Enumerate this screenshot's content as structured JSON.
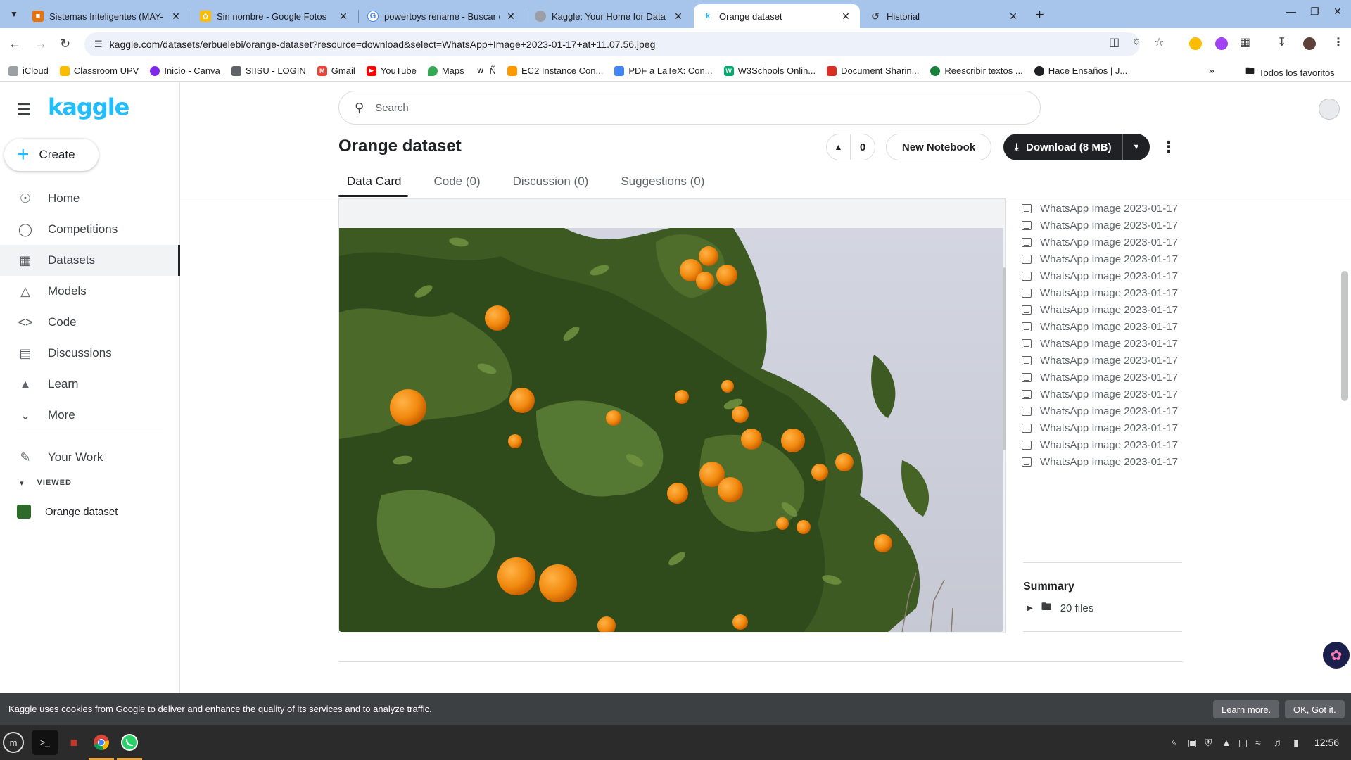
{
  "browser": {
    "tabs": [
      {
        "label": "Sistemas Inteligentes (MAY-",
        "color": "#e8710a"
      },
      {
        "label": "Sin nombre - Google Fotos",
        "color": "#fbbc04"
      },
      {
        "label": "powertoys rename - Buscar c",
        "color": "#4285f4"
      },
      {
        "label": "Kaggle: Your Home for Data",
        "color": "#9aa0a6"
      },
      {
        "label": "Orange dataset",
        "color": "#20beff"
      },
      {
        "label": "Historial",
        "color": "#5f6368"
      }
    ],
    "url": "kaggle.com/datasets/erbuelebi/orange-dataset?resource=download&select=WhatsApp+Image+2023-01-17+at+11.07.56.jpeg",
    "bookmarks": [
      {
        "label": "iCloud",
        "color": "#9aa0a6"
      },
      {
        "label": "Classroom UPV",
        "color": "#fbbc04"
      },
      {
        "label": "Inicio - Canva",
        "color": "#7d2ae8"
      },
      {
        "label": "SIISU - LOGIN",
        "color": "#5f6368"
      },
      {
        "label": "Gmail",
        "color": "#ea4335"
      },
      {
        "label": "YouTube",
        "color": "#ff0000"
      },
      {
        "label": "Maps",
        "color": "#34a853"
      },
      {
        "label": "Ñ",
        "color": "#202124"
      },
      {
        "label": "EC2 Instance Con...",
        "color": "#ff9900"
      },
      {
        "label": "PDF a LaTeX: Con...",
        "color": "#4285f4"
      },
      {
        "label": "W3Schools Onlin...",
        "color": "#04aa6d"
      },
      {
        "label": "Document Sharin...",
        "color": "#d93025"
      },
      {
        "label": "Reescribir textos ...",
        "color": "#188038"
      },
      {
        "label": "Hace Ensaños | J...",
        "color": "#202124"
      }
    ],
    "all_bookmarks": "Todos los favoritos"
  },
  "sidebar": {
    "logo": "kaggle",
    "create_label": "Create",
    "items": [
      {
        "label": "Home",
        "icon": "compass-icon"
      },
      {
        "label": "Competitions",
        "icon": "trophy-icon"
      },
      {
        "label": "Datasets",
        "icon": "table-icon"
      },
      {
        "label": "Models",
        "icon": "models-icon"
      },
      {
        "label": "Code",
        "icon": "code-icon"
      },
      {
        "label": "Discussions",
        "icon": "discussions-icon"
      },
      {
        "label": "Learn",
        "icon": "school-icon"
      },
      {
        "label": "More",
        "icon": "chevron-down-icon"
      }
    ],
    "your_work": "Your Work",
    "viewed_header": "VIEWED",
    "recent_item": "Orange dataset"
  },
  "header": {
    "search_placeholder": "Search",
    "title": "Orange dataset",
    "votes": "0",
    "new_notebook": "New Notebook",
    "download": "Download (8 MB)",
    "tabs": [
      "Data Card",
      "Code (0)",
      "Discussion (0)",
      "Suggestions (0)"
    ]
  },
  "files": [
    "WhatsApp Image 2023-01-17",
    "WhatsApp Image 2023-01-17",
    "WhatsApp Image 2023-01-17",
    "WhatsApp Image 2023-01-17",
    "WhatsApp Image 2023-01-17",
    "WhatsApp Image 2023-01-17",
    "WhatsApp Image 2023-01-17",
    "WhatsApp Image 2023-01-17",
    "WhatsApp Image 2023-01-17",
    "WhatsApp Image 2023-01-17",
    "WhatsApp Image 2023-01-17",
    "WhatsApp Image 2023-01-17",
    "WhatsApp Image 2023-01-17",
    "WhatsApp Image 2023-01-17",
    "WhatsApp Image 2023-01-17",
    "WhatsApp Image 2023-01-17"
  ],
  "summary": {
    "title": "Summary",
    "files": "20 files"
  },
  "cookie": {
    "text": "Kaggle uses cookies from Google to deliver and enhance the quality of its services and to analyze traffic.",
    "learn_more": "Learn more.",
    "ok": "OK, Got it."
  },
  "taskbar": {
    "clock": "12:56"
  },
  "colors": {
    "kaggle_blue": "#20beff",
    "dark_button": "#202124",
    "cookie_bg": "#3c4043"
  }
}
